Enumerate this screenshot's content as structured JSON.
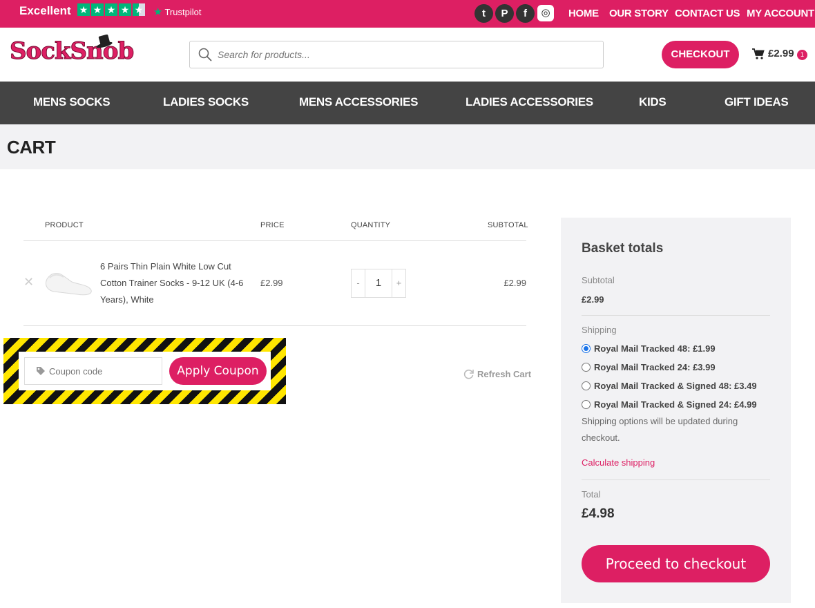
{
  "topbar": {
    "rating_text": "Excellent",
    "trustpilot": "Trustpilot",
    "links": [
      "HOME",
      "OUR STORY",
      "CONTACT US",
      "MY ACCOUNT"
    ]
  },
  "header": {
    "logo": "SockSnob",
    "search_placeholder": "Search for products...",
    "checkout_label": "CHECKOUT",
    "cart_total": "£2.99",
    "cart_count": "1"
  },
  "nav": [
    "MENS SOCKS",
    "LADIES SOCKS",
    "MENS ACCESSORIES",
    "LADIES ACCESSORIES",
    "KIDS",
    "GIFT IDEAS"
  ],
  "page": {
    "title": "CART"
  },
  "cart_table": {
    "headers": {
      "product": "PRODUCT",
      "price": "PRICE",
      "quantity": "QUANTITY",
      "subtotal": "SUBTOTAL"
    },
    "items": [
      {
        "name": "6 Pairs Thin Plain White Low Cut Cotton Trainer Socks - 9-12 UK (4-6 Years), White",
        "price": "£2.99",
        "quantity": "1",
        "subtotal": "£2.99"
      }
    ],
    "qty_minus": "-",
    "qty_plus": "+"
  },
  "coupon": {
    "placeholder": "Coupon code",
    "apply_label": "Apply Coupon",
    "refresh_label": "Refresh Cart"
  },
  "totals": {
    "title": "Basket totals",
    "subtotal_label": "Subtotal",
    "subtotal_value": "£2.99",
    "shipping_label": "Shipping",
    "shipping_options": [
      {
        "label": "Royal Mail Tracked 48: £1.99",
        "selected": true
      },
      {
        "label": "Royal Mail Tracked 24: £3.99",
        "selected": false
      },
      {
        "label": "Royal Mail Tracked & Signed 48: £3.49",
        "selected": false
      },
      {
        "label": "Royal Mail Tracked & Signed 24: £4.99",
        "selected": false
      }
    ],
    "shipping_note": "Shipping options will be updated during checkout.",
    "calc_shipping": "Calculate shipping",
    "total_label": "Total",
    "total_value": "£4.98",
    "proceed_label": "Proceed to checkout"
  },
  "colors": {
    "brand": "#dd1f63",
    "nav_bg": "#444444",
    "trustpilot": "#00b67a",
    "selected_radio": "#1a73e8"
  }
}
